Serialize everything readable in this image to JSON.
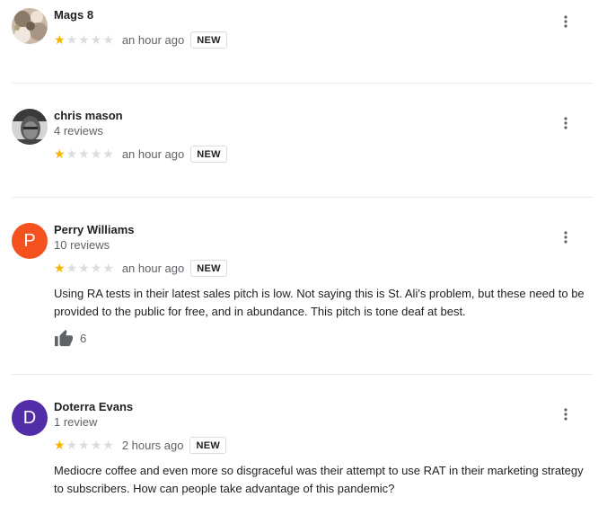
{
  "reviews": [
    {
      "name": "Mags 8",
      "review_count": "",
      "stars": 1,
      "max_stars": 5,
      "time": "an hour ago",
      "badge": "NEW",
      "text": "",
      "likes": ""
    },
    {
      "name": "chris mason",
      "review_count": "4 reviews",
      "stars": 1,
      "max_stars": 5,
      "time": "an hour ago",
      "badge": "NEW",
      "text": "",
      "likes": ""
    },
    {
      "name": "Perry Williams",
      "avatar_letter": "P",
      "avatar_color": "#f4511e",
      "review_count": "10 reviews",
      "stars": 1,
      "max_stars": 5,
      "time": "an hour ago",
      "badge": "NEW",
      "text": "Using RA tests in their latest sales pitch is low. Not saying this is St. Ali's problem, but these need to be provided to the public for free, and in abundance. This pitch is tone deaf at best.",
      "likes": "6"
    },
    {
      "name": "Doterra Evans",
      "avatar_letter": "D",
      "avatar_color": "#512da8",
      "review_count": "1 review",
      "stars": 1,
      "max_stars": 5,
      "time": "2 hours ago",
      "badge": "NEW",
      "text": "Mediocre coffee and even more so disgraceful was their attempt to use RAT in their marketing strategy to subscribers. How can people take advantage of this pandemic?",
      "likes": ""
    }
  ],
  "icons": {
    "more": "more-vert-icon",
    "like": "thumb-up-icon",
    "star": "star-icon"
  },
  "colors": {
    "star_filled": "#f4b400",
    "star_empty": "#dadce0",
    "divider": "#e8eaed",
    "secondary_text": "#5f6368"
  }
}
